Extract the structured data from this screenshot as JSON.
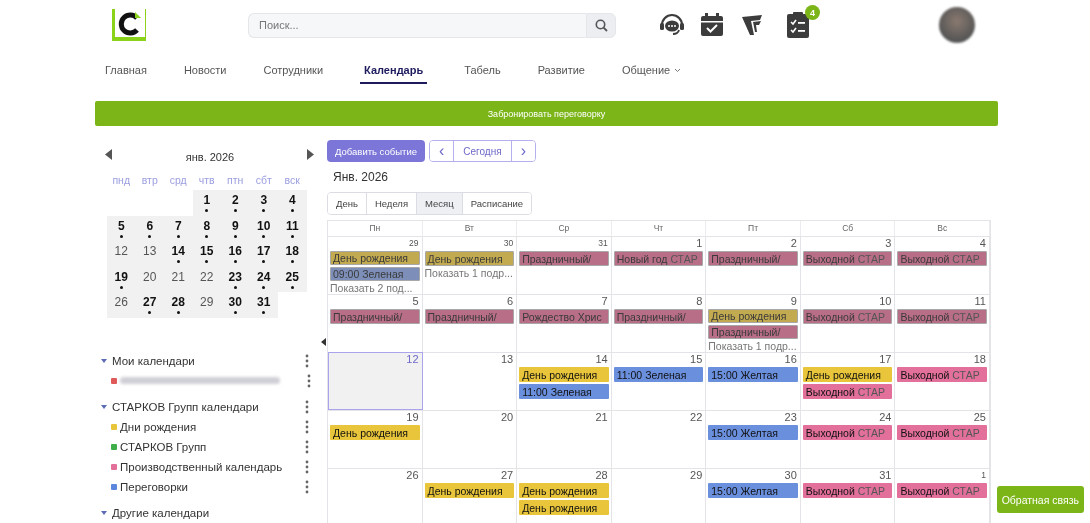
{
  "header": {
    "search": {
      "placeholder": "Поиск..."
    },
    "tasks_badge": "4"
  },
  "nav": [
    {
      "label": "Главная",
      "selected": false
    },
    {
      "label": "Новости",
      "selected": false
    },
    {
      "label": "Сотрудники",
      "selected": false
    },
    {
      "label": "Календарь",
      "selected": true
    },
    {
      "label": "Табель",
      "selected": false
    },
    {
      "label": "Развитие",
      "selected": false
    },
    {
      "label": "Общение",
      "selected": false,
      "dropdown": true
    }
  ],
  "book_button": "Забронировать переговорку",
  "mini_calendar": {
    "title": "янв. 2026",
    "weekdays": [
      "пнд",
      "втр",
      "срд",
      "чтв",
      "птн",
      "сбт",
      "вск"
    ],
    "weeks": [
      [
        {
          "kind": "blank"
        },
        {
          "kind": "blank"
        },
        {
          "kind": "blank"
        },
        {
          "kind": "day",
          "day": "1",
          "has_events": true
        },
        {
          "kind": "day",
          "day": "2",
          "has_events": true
        },
        {
          "kind": "day",
          "day": "3",
          "has_events": true
        },
        {
          "kind": "day",
          "day": "4",
          "has_events": true
        }
      ],
      [
        {
          "kind": "day",
          "day": "5",
          "has_events": true
        },
        {
          "kind": "day",
          "day": "6",
          "has_events": true
        },
        {
          "kind": "day",
          "day": "7",
          "has_events": true
        },
        {
          "kind": "day",
          "day": "8",
          "has_events": true
        },
        {
          "kind": "day",
          "day": "9",
          "has_events": true
        },
        {
          "kind": "day",
          "day": "10",
          "has_events": true
        },
        {
          "kind": "day",
          "day": "11",
          "has_events": true
        }
      ],
      [
        {
          "kind": "day",
          "day": "12",
          "has_events": false
        },
        {
          "kind": "day",
          "day": "13",
          "has_events": false
        },
        {
          "kind": "day",
          "day": "14",
          "has_events": true
        },
        {
          "kind": "day",
          "day": "15",
          "has_events": true
        },
        {
          "kind": "day",
          "day": "16",
          "has_events": true
        },
        {
          "kind": "day",
          "day": "17",
          "has_events": true
        },
        {
          "kind": "day",
          "day": "18",
          "has_events": true
        }
      ],
      [
        {
          "kind": "day",
          "day": "19",
          "has_events": true
        },
        {
          "kind": "day",
          "day": "20",
          "has_events": false
        },
        {
          "kind": "day",
          "day": "21",
          "has_events": false
        },
        {
          "kind": "day",
          "day": "22",
          "has_events": false
        },
        {
          "kind": "day",
          "day": "23",
          "has_events": true
        },
        {
          "kind": "day",
          "day": "24",
          "has_events": true
        },
        {
          "kind": "day",
          "day": "25",
          "has_events": true
        }
      ],
      [
        {
          "kind": "day",
          "day": "26",
          "has_events": false
        },
        {
          "kind": "day",
          "day": "27",
          "has_events": true
        },
        {
          "kind": "day",
          "day": "28",
          "has_events": true
        },
        {
          "kind": "day",
          "day": "29",
          "has_events": false
        },
        {
          "kind": "day",
          "day": "30",
          "has_events": true
        },
        {
          "kind": "day",
          "day": "31",
          "has_events": true
        },
        {
          "kind": "blank"
        }
      ]
    ]
  },
  "calendar_groups": [
    {
      "title": "Мои календари",
      "expanded": true,
      "items": [
        {
          "kind": "redacted",
          "color": "#e05a5a"
        }
      ]
    },
    {
      "title": "СТАРКОВ Групп календари",
      "expanded": true,
      "items": [
        {
          "kind": "calendar",
          "name": "Дни рождения",
          "color": "#e8c53a"
        },
        {
          "kind": "calendar",
          "name": "СТАРКОВ Групп",
          "color": "#3fae49"
        },
        {
          "kind": "calendar",
          "name": "Производственный календарь",
          "color": "#e3709a"
        },
        {
          "kind": "calendar",
          "name": "Переговорки",
          "color": "#5b86dd"
        }
      ]
    },
    {
      "title": "Другие календари",
      "expanded": true
    }
  ],
  "toolbar": {
    "add_button": "Добавить событие",
    "prev": "‹",
    "today": "Сегодня",
    "next": "›"
  },
  "period_title": "Янв. 2026",
  "views": [
    {
      "label": "День",
      "selected": false
    },
    {
      "label": "Неделя",
      "selected": false
    },
    {
      "label": "Месяц",
      "selected": true
    },
    {
      "label": "Расписание",
      "selected": false
    }
  ],
  "month": {
    "weekdays": [
      "Пн",
      "Вт",
      "Ср",
      "Чт",
      "Пт",
      "Сб",
      "Вс"
    ],
    "weeks": [
      [
        {
          "day": "29",
          "other_month": true,
          "today": false,
          "events": [
            {
              "kind": "birthday",
              "past": true,
              "title": "День рождения"
            },
            {
              "kind": "meeting",
              "past": true,
              "time": "09:00",
              "title": "Зеленая"
            }
          ],
          "more": "Показать 2 под..."
        },
        {
          "day": "30",
          "other_month": true,
          "today": false,
          "events": [
            {
              "kind": "birthday",
              "past": true,
              "title": "День рождения"
            }
          ],
          "more": "Показать 1 подр..."
        },
        {
          "day": "31",
          "other_month": true,
          "today": false,
          "events": [
            {
              "kind": "holiday",
              "past": true,
              "title": "Праздничный/"
            }
          ]
        },
        {
          "day": "1",
          "other_month": false,
          "today": false,
          "events": [
            {
              "kind": "holiday",
              "past": true,
              "title": "Новый год",
              "calendar": "СТАР"
            }
          ]
        },
        {
          "day": "2",
          "other_month": false,
          "today": false,
          "events": [
            {
              "kind": "holiday",
              "past": true,
              "title": "Праздничный/"
            }
          ]
        },
        {
          "day": "3",
          "other_month": false,
          "today": false,
          "events": [
            {
              "kind": "holiday",
              "past": true,
              "title": "Выходной",
              "calendar": "СТАР"
            }
          ]
        },
        {
          "day": "4",
          "other_month": false,
          "today": false,
          "events": [
            {
              "kind": "holiday",
              "past": true,
              "title": "Выходной",
              "calendar": "СТАР"
            }
          ]
        }
      ],
      [
        {
          "day": "5",
          "other_month": false,
          "today": false,
          "events": [
            {
              "kind": "holiday",
              "past": true,
              "title": "Праздничный/"
            }
          ]
        },
        {
          "day": "6",
          "other_month": false,
          "today": false,
          "events": [
            {
              "kind": "holiday",
              "past": true,
              "title": "Праздничный/"
            }
          ]
        },
        {
          "day": "7",
          "other_month": false,
          "today": false,
          "events": [
            {
              "kind": "holiday",
              "past": true,
              "title": "Рождество Хрис"
            }
          ]
        },
        {
          "day": "8",
          "other_month": false,
          "today": false,
          "events": [
            {
              "kind": "holiday",
              "past": true,
              "title": "Праздничный/"
            }
          ]
        },
        {
          "day": "9",
          "other_month": false,
          "today": false,
          "events": [
            {
              "kind": "birthday",
              "past": true,
              "title": "День рождения"
            },
            {
              "kind": "holiday",
              "past": true,
              "title": "Праздничный/"
            }
          ],
          "more": "Показать 1 подр..."
        },
        {
          "day": "10",
          "other_month": false,
          "today": false,
          "events": [
            {
              "kind": "holiday",
              "past": true,
              "title": "Выходной",
              "calendar": "СТАР"
            }
          ]
        },
        {
          "day": "11",
          "other_month": false,
          "today": false,
          "events": [
            {
              "kind": "holiday",
              "past": true,
              "title": "Выходной",
              "calendar": "СТАР"
            }
          ]
        }
      ],
      [
        {
          "day": "12",
          "other_month": false,
          "today": true
        },
        {
          "day": "13",
          "other_month": false,
          "today": false
        },
        {
          "day": "14",
          "other_month": false,
          "today": false,
          "events": [
            {
              "kind": "birthday",
              "past": false,
              "title": "День рождения"
            },
            {
              "kind": "meeting",
              "past": false,
              "time": "11:00",
              "title": "Зеленая"
            }
          ]
        },
        {
          "day": "15",
          "other_month": false,
          "today": false,
          "events": [
            {
              "kind": "meeting",
              "past": false,
              "time": "11:00",
              "title": "Зеленая"
            }
          ]
        },
        {
          "day": "16",
          "other_month": false,
          "today": false,
          "events": [
            {
              "kind": "meeting",
              "past": false,
              "time": "15:00",
              "title": "Желтая"
            }
          ]
        },
        {
          "day": "17",
          "other_month": false,
          "today": false,
          "events": [
            {
              "kind": "birthday",
              "past": false,
              "title": "День рождения"
            },
            {
              "kind": "holiday",
              "past": false,
              "title": "Выходной",
              "calendar": "СТАР"
            }
          ]
        },
        {
          "day": "18",
          "other_month": false,
          "today": false,
          "events": [
            {
              "kind": "holiday",
              "past": false,
              "title": "Выходной",
              "calendar": "СТАР"
            }
          ]
        }
      ],
      [
        {
          "day": "19",
          "other_month": false,
          "today": false,
          "events": [
            {
              "kind": "birthday",
              "past": false,
              "title": "День рождения"
            }
          ]
        },
        {
          "day": "20",
          "other_month": false,
          "today": false
        },
        {
          "day": "21",
          "other_month": false,
          "today": false
        },
        {
          "day": "22",
          "other_month": false,
          "today": false
        },
        {
          "day": "23",
          "other_month": false,
          "today": false,
          "events": [
            {
              "kind": "meeting",
              "past": false,
              "time": "15:00",
              "title": "Желтая"
            }
          ]
        },
        {
          "day": "24",
          "other_month": false,
          "today": false,
          "events": [
            {
              "kind": "holiday",
              "past": false,
              "title": "Выходной",
              "calendar": "СТАР"
            }
          ]
        },
        {
          "day": "25",
          "other_month": false,
          "today": false,
          "events": [
            {
              "kind": "holiday",
              "past": false,
              "title": "Выходной",
              "calendar": "СТАР"
            }
          ]
        }
      ],
      [
        {
          "day": "26",
          "other_month": false,
          "today": false
        },
        {
          "day": "27",
          "other_month": false,
          "today": false,
          "events": [
            {
              "kind": "birthday",
              "past": false,
              "title": "День рождения"
            }
          ]
        },
        {
          "day": "28",
          "other_month": false,
          "today": false,
          "events": [
            {
              "kind": "birthday",
              "past": false,
              "title": "День рождения"
            },
            {
              "kind": "birthday",
              "past": false,
              "title": "День рождения"
            }
          ]
        },
        {
          "day": "29",
          "other_month": false,
          "today": false
        },
        {
          "day": "30",
          "other_month": false,
          "today": false,
          "events": [
            {
              "kind": "meeting",
              "past": false,
              "time": "15:00",
              "title": "Желтая"
            }
          ]
        },
        {
          "day": "31",
          "other_month": false,
          "today": false,
          "events": [
            {
              "kind": "holiday",
              "past": false,
              "title": "Выходной",
              "calendar": "СТАР"
            }
          ]
        },
        {
          "day": "1",
          "other_month": true,
          "today": false,
          "events": [
            {
              "kind": "holiday",
              "past": false,
              "title": "Выходной",
              "calendar": "СТАР"
            }
          ]
        }
      ]
    ]
  },
  "feedback_button": "Обратная связь"
}
